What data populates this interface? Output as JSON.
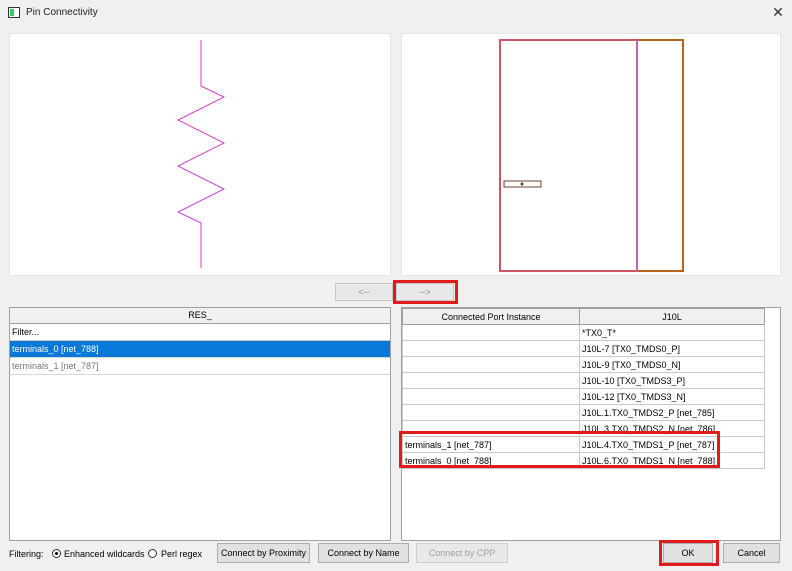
{
  "window": {
    "title": "Pin Connectivity",
    "close_label": "✕"
  },
  "nav": {
    "left_label": "<--",
    "right_label": "-->"
  },
  "left_list": {
    "header": "RES_",
    "filter": "Filter...",
    "items": [
      "terminals_0 [net_788]",
      "terminals_1 [net_787]"
    ]
  },
  "right_table": {
    "col1": "Connected Port Instance",
    "col2": "J10L",
    "rows": [
      [
        "",
        "*TX0_T*"
      ],
      [
        "",
        "J10L-7 [TX0_TMDS0_P]"
      ],
      [
        "",
        "J10L-9 [TX0_TMDS0_N]"
      ],
      [
        "",
        "J10L-10 [TX0_TMDS3_P]"
      ],
      [
        "",
        "J10L-12 [TX0_TMDS3_N]"
      ],
      [
        "",
        "J10L.1.TX0_TMDS2_P [net_785]"
      ],
      [
        "",
        "J10L.3.TX0_TMDS2_N [net_786]"
      ],
      [
        "terminals_1 [net_787]",
        "J10L.4.TX0_TMDS1_P [net_787]"
      ],
      [
        "terminals_0 [net_788]",
        "J10L.6.TX0_TMDS1_N [net_788]"
      ]
    ]
  },
  "footer": {
    "filtering_label": "Filtering:",
    "opt_wildcards": "Enhanced wildcards",
    "opt_regex": "Perl regex",
    "btn_proximity": "Connect by Proximity",
    "btn_name": "Connect by Name",
    "btn_cpp": "Connect by CPP",
    "btn_ok": "OK",
    "btn_cancel": "Cancel"
  },
  "colors": {
    "highlight": "#e01b1b",
    "selection": "#0a78d7",
    "resistor": "#cc44cc"
  }
}
